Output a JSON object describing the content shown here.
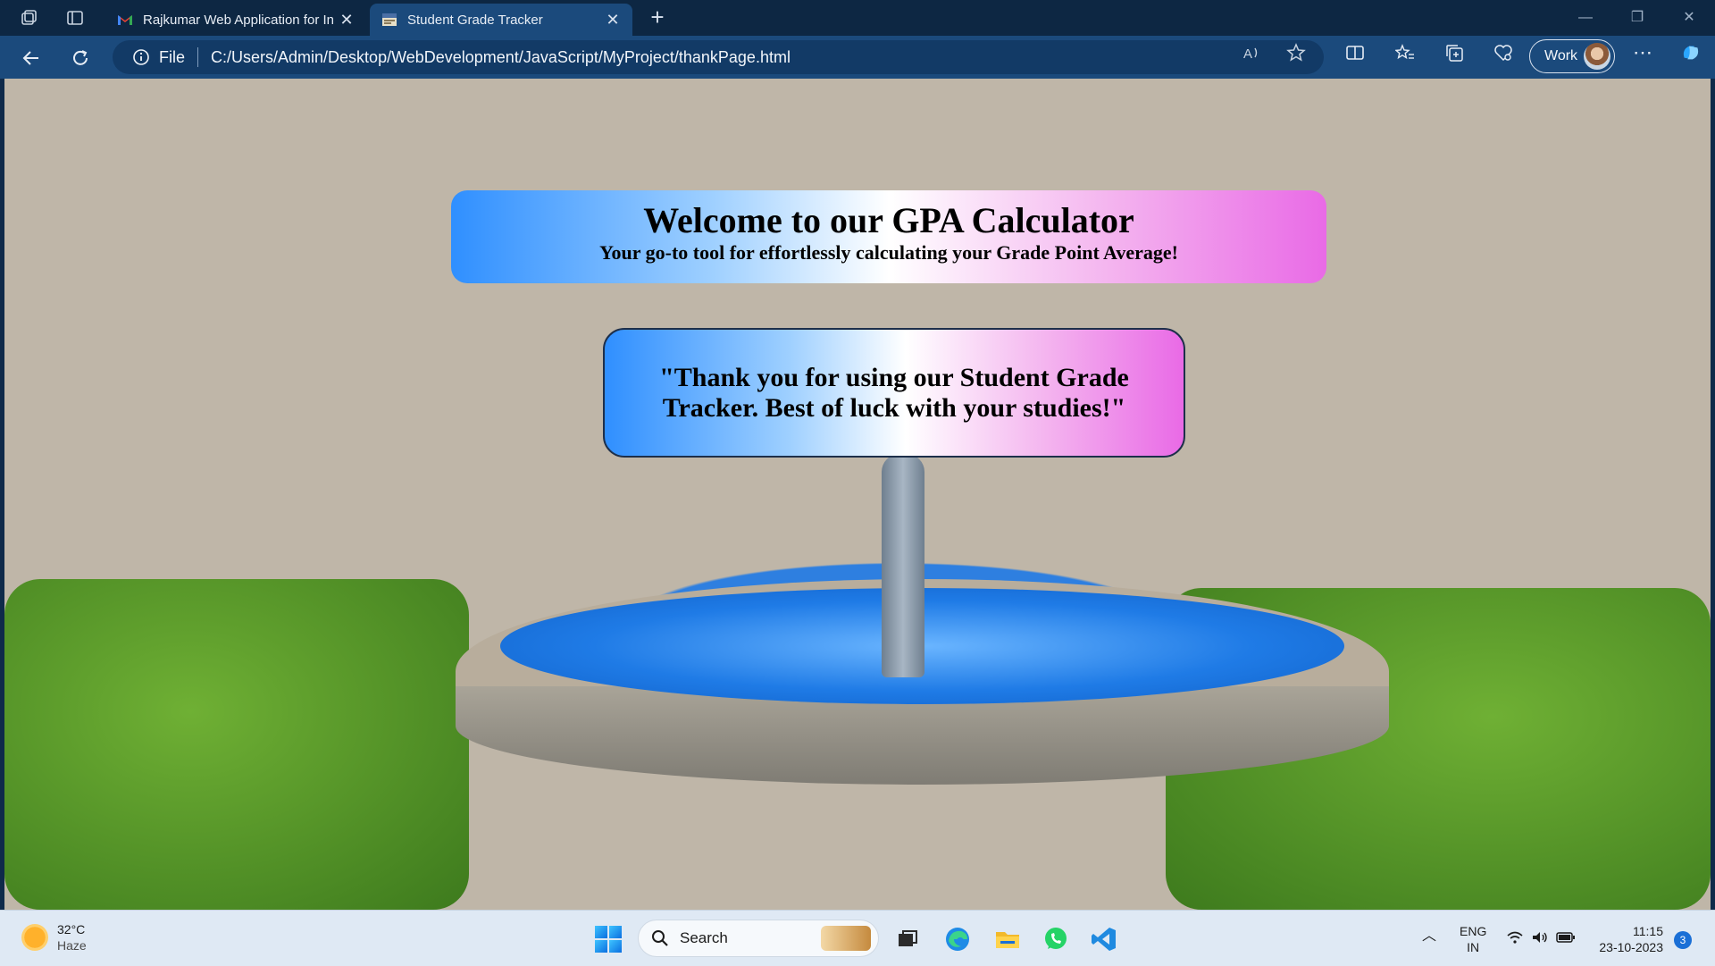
{
  "browser": {
    "tabs": [
      {
        "title": "Rajkumar Web Application for In",
        "favicon": "gmail-icon",
        "active": false
      },
      {
        "title": "Student Grade Tracker",
        "favicon": "page-icon",
        "active": true
      }
    ],
    "address": {
      "scheme_label": "File",
      "url": "C:/Users/Admin/Desktop/WebDevelopment/JavaScript/MyProject/thankPage.html"
    },
    "profile_label": "Work"
  },
  "page": {
    "welcome_title": "Welcome to our GPA Calculator",
    "welcome_subtitle": "Your go-to tool for effortlessly calculating your Grade Point Average!",
    "thanks_message": "\"Thank you for using our Student Grade Tracker. Best of luck with your studies!\""
  },
  "taskbar": {
    "weather": {
      "temp": "32°C",
      "condition": "Haze"
    },
    "search_placeholder": "Search",
    "apps": [
      "start-icon",
      "task-view-icon",
      "edge-icon",
      "file-explorer-icon",
      "whatsapp-icon",
      "vscode-icon"
    ],
    "language": {
      "line1": "ENG",
      "line2": "IN"
    },
    "clock": {
      "time": "11:15",
      "date": "23-10-2023"
    },
    "notifications": "3"
  },
  "colors": {
    "accent": "#1b4a7c",
    "gradient_start": "#2f8fff",
    "gradient_end": "#e96ae6"
  }
}
